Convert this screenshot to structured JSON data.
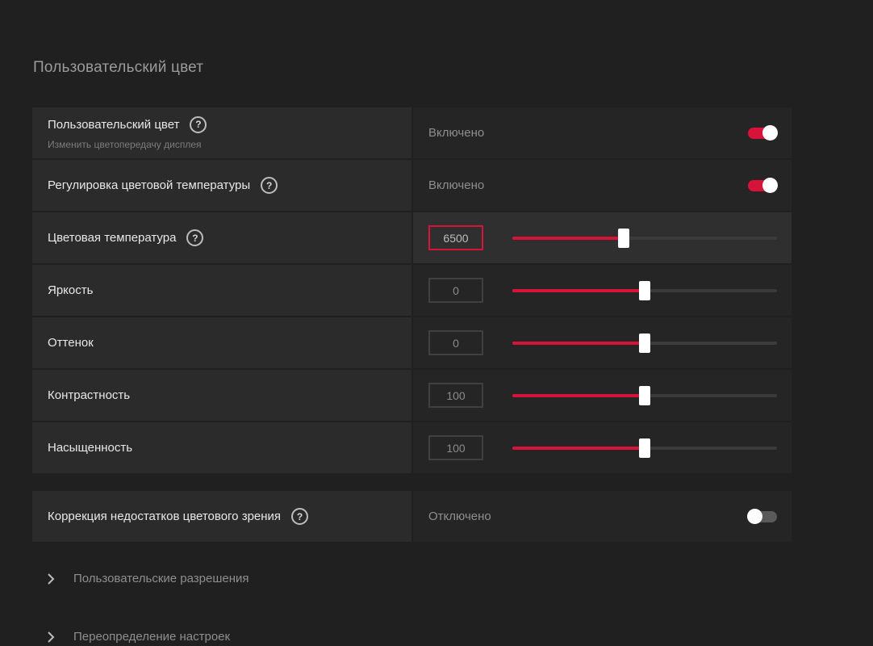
{
  "section_title": "Пользовательский цвет",
  "rows": [
    {
      "label": "Пользовательский цвет",
      "sublabel": "Изменить цветопередачу дисплея",
      "status": "Включено",
      "toggle": "on"
    },
    {
      "label": "Регулировка цветовой температуры",
      "status": "Включено",
      "toggle": "on"
    },
    {
      "label": "Цветовая температура",
      "value": "6500",
      "slider_fraction": 0.42
    },
    {
      "label": "Яркость",
      "value": "0",
      "slider_fraction": 0.5
    },
    {
      "label": "Оттенок",
      "value": "0",
      "slider_fraction": 0.5
    },
    {
      "label": "Контрастность",
      "value": "100",
      "slider_fraction": 0.5
    },
    {
      "label": "Насыщенность",
      "value": "100",
      "slider_fraction": 0.5
    }
  ],
  "vision_row": {
    "label": "Коррекция недостатков цветового зрения",
    "status": "Отключено",
    "toggle": "off"
  },
  "expanders": [
    {
      "label": "Пользовательские разрешения"
    },
    {
      "label": "Переопределение настроек"
    }
  ],
  "colors": {
    "accent": "#d8133a",
    "background": "#202020",
    "row_left": "#2b2b2b",
    "row_right": "#252525"
  }
}
